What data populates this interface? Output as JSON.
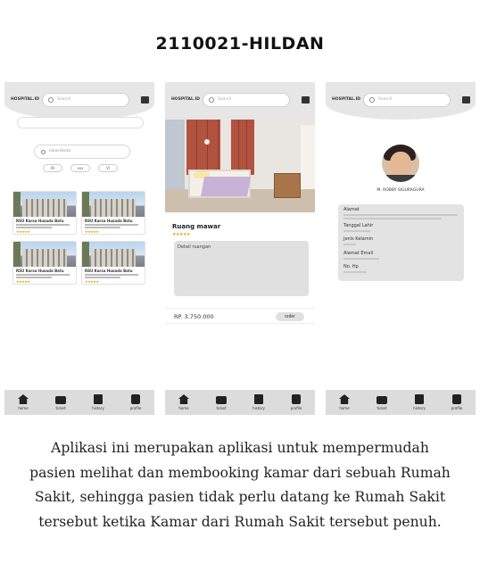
{
  "page": {
    "title": "2110021-HILDAN"
  },
  "header": {
    "brand": "HOSPITAL.ID",
    "search_placeholder": "Search"
  },
  "nav": [
    {
      "label": "home",
      "icon": "home-icon"
    },
    {
      "label": "ticket",
      "icon": "ticket-icon"
    },
    {
      "label": "history",
      "icon": "history-icon"
    },
    {
      "label": "profile",
      "icon": "profile-icon"
    }
  ],
  "screen1": {
    "location_placeholder": "lokasi/kota",
    "filters": [
      "All",
      "xxx",
      "VI"
    ],
    "hospitals": [
      {
        "name": "RSU Karsa Husada Batu"
      },
      {
        "name": "RSU Karsa Husada Batu"
      },
      {
        "name": "RSU Karsa Husada Batu"
      },
      {
        "name": "RSU Karsa Husada Batu"
      }
    ],
    "stars": "★★★★★"
  },
  "screen2": {
    "room_name": "Ruang mawar",
    "stars": "★★★★★",
    "detail_label": "Detail ruangan",
    "price": "RP. 3.750.000",
    "order_label": "order"
  },
  "screen3": {
    "name": "M. ROBBY SIGURAGURA",
    "fields": [
      {
        "label": "Alamat"
      },
      {
        "label": "Tanggal Lahir"
      },
      {
        "label": "Jenis Kelamin"
      },
      {
        "label": "Alamat Email"
      },
      {
        "label": "No. Hp"
      }
    ]
  },
  "description": "Aplikasi ini merupakan aplikasi untuk mempermudah pasien melihat dan membooking kamar dari sebuah Rumah Sakit, sehingga pasien tidak perlu datang ke Rumah Sakit tersebut ketika Kamar dari Rumah Sakit tersebut penuh."
}
